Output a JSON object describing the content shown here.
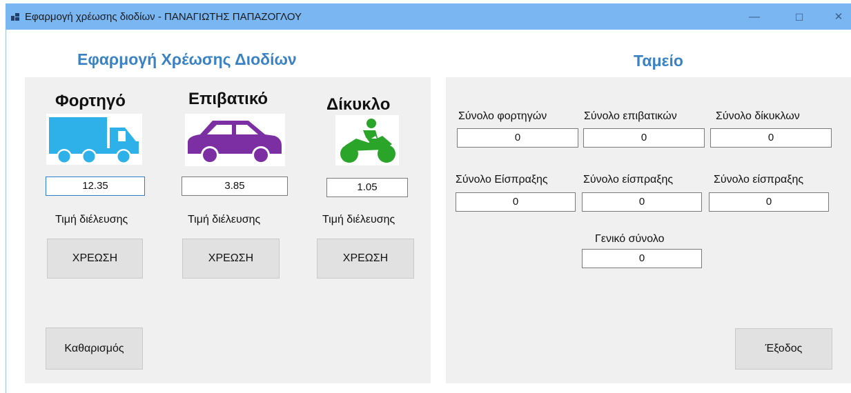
{
  "window": {
    "title": "Εφαρμογή χρέωσης διοδίων - ΠΑΝΑΓΙΩΤΗΣ ΠΑΠΑΖΟΓΛΟΥ",
    "minimize_glyph": "—",
    "maximize_glyph": "☐",
    "close_glyph": "✕"
  },
  "left": {
    "heading": "Εφαρμογή Χρέωσης Διοδίων",
    "vehicles": [
      {
        "name": "Φορτηγό",
        "icon": "truck-icon",
        "price": "12.35",
        "caption": "Τιμή διέλευσης",
        "button": "ΧΡΕΩΣΗ"
      },
      {
        "name": "Επιβατικό",
        "icon": "car-icon",
        "price": "3.85",
        "caption": "Τιμή διέλευσης",
        "button": "ΧΡΕΩΣΗ"
      },
      {
        "name": "Δίκυκλο",
        "icon": "motorcycle-icon",
        "price": "1.05",
        "caption": "Τιμή διέλευσης",
        "button": "ΧΡΕΩΣΗ"
      }
    ],
    "clear_button": "Καθαρισμός"
  },
  "right": {
    "heading": "Ταμείο",
    "totals": [
      {
        "label": "Σύνολο φορτηγών",
        "value": "0"
      },
      {
        "label": "Σύνολο επιβατικών",
        "value": "0"
      },
      {
        "label": "Σύνολο δίκυκλων",
        "value": "0"
      }
    ],
    "revenue": [
      {
        "label": "Σύνολο Είσπραξης",
        "value": "0"
      },
      {
        "label": "Σύνολο είσπραξης",
        "value": "0"
      },
      {
        "label": "Σύνολο είσπραξης",
        "value": "0"
      }
    ],
    "grand_total": {
      "label": "Γενικό σύνολο",
      "value": "0"
    },
    "exit_button": "Έξοδος"
  },
  "colors": {
    "titlebar": "#79b6f2",
    "heading": "#3b82c4",
    "truck": "#2eb0e9",
    "car": "#7b2fa3",
    "motorcycle": "#2aa52a",
    "panel": "#f0f0f0",
    "button": "#e1e1e1"
  }
}
